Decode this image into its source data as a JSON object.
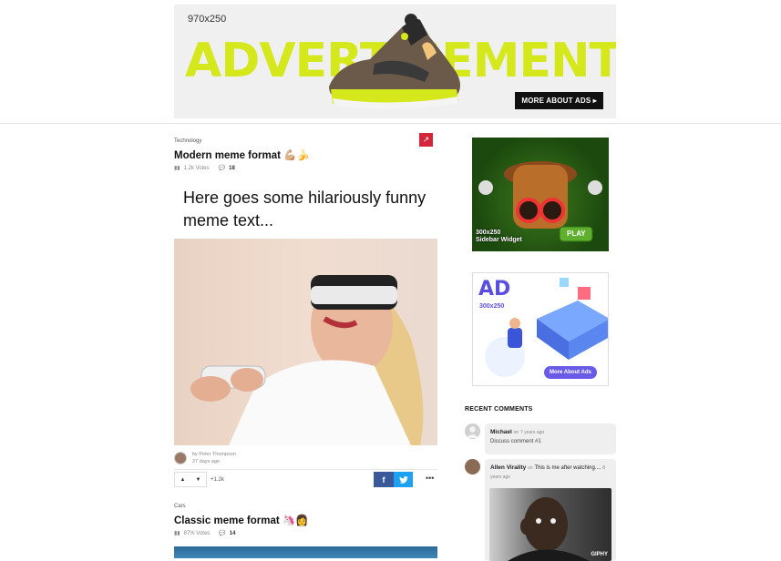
{
  "header_ad": {
    "size_label": "970x250",
    "headline": "ADVERTISEMENT",
    "cta": "MORE ABOUT ADS ▸"
  },
  "posts": [
    {
      "category": "Technology",
      "title": "Modern meme format 💪🏼🍌",
      "votes": "1.2k Votes",
      "comments": "18",
      "meme_text": "Here goes some hilariously funny meme text...",
      "author_prefix": "by",
      "author": "Peter Thompson",
      "time": "27 days ago",
      "score": "+1.2k",
      "share_fb": "f",
      "more": "•••"
    },
    {
      "category": "Cars",
      "title": "Classic meme format 🦄👩",
      "votes": "87% Votes",
      "comments": "14"
    }
  ],
  "sidebar": {
    "ad1": {
      "label_line1": "300x250",
      "label_line2": "Sidebar Widget",
      "play": "PLAY"
    },
    "ad2": {
      "big": "AD",
      "size": "300x250",
      "cta": "More About Ads"
    },
    "recent_title": "RECENT COMMENTS",
    "comments": [
      {
        "name": "Michael",
        "on": "on",
        "ago": "7 years ago",
        "text": "Discuss comment #1"
      },
      {
        "name": "Allen Virality",
        "on": "on",
        "target": "This is me after watching....",
        "ago": "8 years ago",
        "giphy": "GIPHY"
      }
    ]
  },
  "colors": {
    "accent_red": "#d4263b",
    "ad_lime": "#d5e81b",
    "facebook": "#3b5998",
    "twitter": "#1da1f2",
    "ad_purple": "#5a4ee0"
  }
}
